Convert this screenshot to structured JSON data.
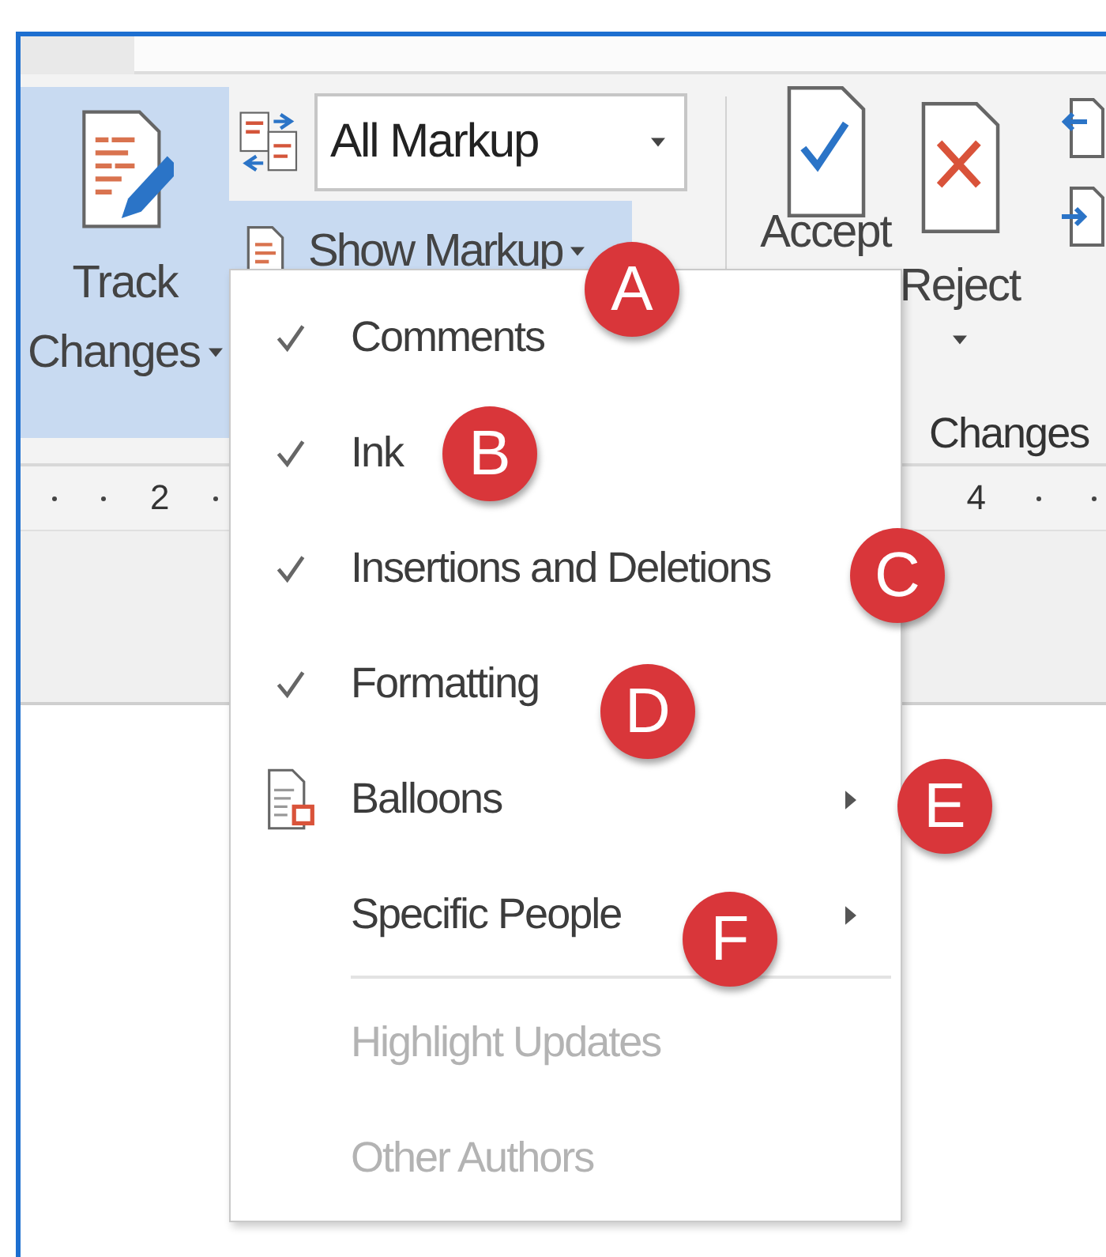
{
  "ribbon": {
    "track_changes": {
      "lines": [
        "Track",
        "Changes"
      ],
      "on": true
    },
    "markup_dropdown": {
      "value": "All Markup"
    },
    "show_markup": {
      "label": "Show Markup",
      "expanded": true
    },
    "accept": {
      "label": "Accept"
    },
    "reject": {
      "label": "Reject"
    },
    "group_label": "Changes"
  },
  "ruler": {
    "labels": [
      "2",
      "4"
    ]
  },
  "menu": {
    "items": [
      {
        "kind": "check",
        "label": "Comments",
        "checked": true,
        "submenu": false,
        "disabled": false
      },
      {
        "kind": "check",
        "label": "Ink",
        "checked": true,
        "submenu": false,
        "disabled": false
      },
      {
        "kind": "check",
        "label": "Insertions and Deletions",
        "checked": true,
        "submenu": false,
        "disabled": false
      },
      {
        "kind": "check",
        "label": "Formatting",
        "checked": true,
        "submenu": false,
        "disabled": false
      },
      {
        "kind": "icon",
        "label": "Balloons",
        "checked": false,
        "submenu": true,
        "disabled": false
      },
      {
        "kind": "check",
        "label": "Specific People",
        "checked": false,
        "submenu": true,
        "disabled": false
      },
      {
        "kind": "separator"
      },
      {
        "kind": "check",
        "label": "Highlight Updates",
        "checked": false,
        "submenu": false,
        "disabled": true
      },
      {
        "kind": "check",
        "label": "Other Authors",
        "checked": false,
        "submenu": false,
        "disabled": true
      }
    ]
  },
  "annotations": [
    {
      "letter": "A"
    },
    {
      "letter": "B"
    },
    {
      "letter": "C"
    },
    {
      "letter": "D"
    },
    {
      "letter": "E"
    },
    {
      "letter": "F"
    }
  ]
}
